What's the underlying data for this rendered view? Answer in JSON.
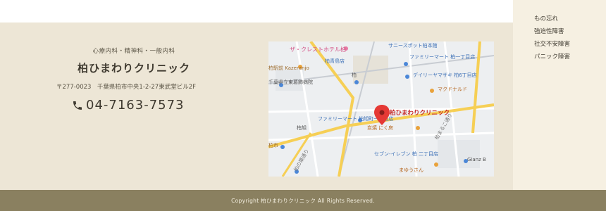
{
  "clinic": {
    "subtitle": "心療内科・精神科・一般内科",
    "name": "柏ひまわりクリニック",
    "address": "〒277-0023　千葉県柏市中央1-2-27東武堂ビル2F",
    "phone": "04-7163-7573"
  },
  "side_menu": {
    "items": [
      "もの忘れ",
      "強迫性障害",
      "社交不安障害",
      "パニック障害"
    ]
  },
  "map": {
    "pin_label": "柏ひまわりクリニック",
    "labels": {
      "hotel": "ザ・クレストホテル柏",
      "sunny": "サニースポット柏本館",
      "family_top": "ファミリーマート 柏一丁目店",
      "daily": "デイリーヤマザキ 柏6丁目店",
      "kashiwa_kenpo": "柏青島店",
      "kashiwa_takashimaya": "柏高島屋",
      "kazeranjo": "柏駅前 Kazeranjo",
      "chiba_ken": "千葉県立東葛飾病院",
      "kashiwa_st": "柏",
      "mcdonalds": "マクドナルド",
      "family_mid": "ファミリーマート 柏旭町一丁目店",
      "niku": "炭焼 にく房",
      "kashiwa_area": "柏市",
      "shop_low": "柏旭",
      "seven": "セブン-イレブン 柏 二丁目店",
      "mayu": "まゆうさん",
      "gianz": "Gianz B",
      "road_right": "柏まるこ通り",
      "road_left": "柏の葉通り"
    }
  },
  "footer": {
    "copyright": "Copyright 柏ひまわりクリニック All Rights Reserved."
  },
  "colors": {
    "footer_bg": "#ede6d6",
    "side_bg": "#f6f0e2",
    "copyright_bg": "#8a8060",
    "map_road_yellow": "#f6cf55",
    "map_pin": "#e53935"
  }
}
